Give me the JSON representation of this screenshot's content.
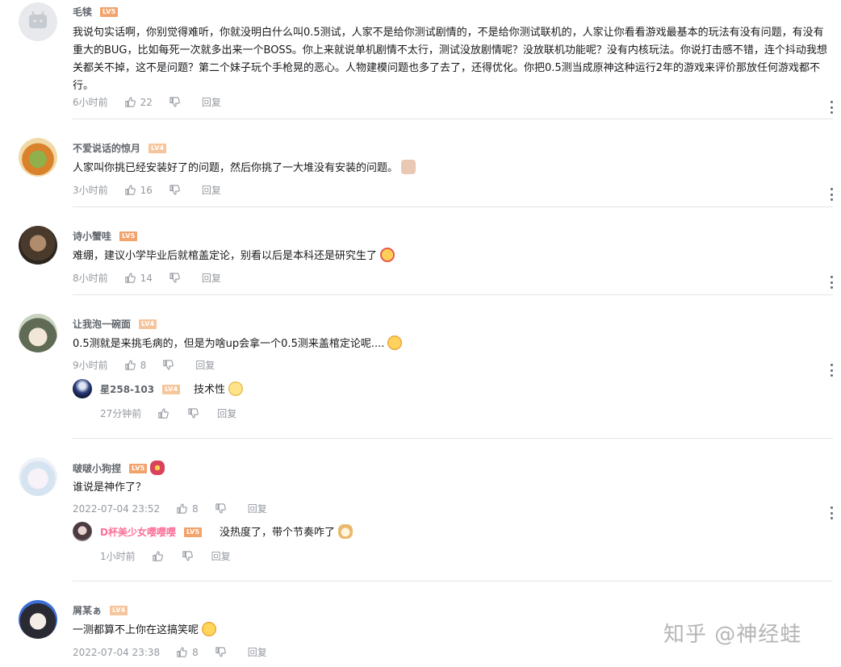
{
  "comments": [
    {
      "username": "毛犊",
      "level": "LV5",
      "text": "我说句实话啊，你别觉得难听，你就没明白什么叫0.5测试，人家不是给你测试剧情的，不是给你测试联机的，人家让你看看游戏最基本的玩法有没有问题，有没有重大的BUG，比如每死一次就多出来一个BOSS。你上来就说单机剧情不太行，测试没放剧情呢？没放联机功能呢？没有内核玩法。你说打击感不错，连个抖动我想关都关不掉，这不是问题？第二个妹子玩个手枪晃的恶心。人物建模问题也多了去了，还得优化。你把0.5测当成原神这种运行2年的游戏来评价那放任何游戏都不行。",
      "time": "6小时前",
      "likes": "22",
      "reply_label": "回复"
    },
    {
      "username": "不爱说话的惊月",
      "level": "LV4",
      "text": "人家叫你挑已经安装好了的问题，然后你挑了一大堆没有安装的问题。",
      "time": "3小时前",
      "likes": "16",
      "reply_label": "回复"
    },
    {
      "username": "诗小蟹哇",
      "level": "LV5",
      "text": "难绷，建议小学毕业后就棺盖定论，别看以后是本科还是研究生了",
      "time": "8小时前",
      "likes": "14",
      "reply_label": "回复"
    },
    {
      "username": "让我泡一碗面",
      "level": "LV4",
      "text": "0.5测就是来挑毛病的，但是为啥up会拿一个0.5测来盖棺定论呢....",
      "time": "9小时前",
      "likes": "8",
      "reply_label": "回复",
      "sub_reply": {
        "username": "星258-103",
        "level": "LV4",
        "text": "技术性",
        "time": "27分钟前",
        "reply_label": "回复"
      }
    },
    {
      "username": "啵啵小狗捏",
      "level": "LV5",
      "text": "谁说是神作了？",
      "time": "2022-07-04 23:52",
      "likes": "8",
      "reply_label": "回复",
      "sub_reply": {
        "username": "D杯美少女嘤嘤嘤",
        "level": "LV5",
        "text": "没热度了，带个节奏咋了",
        "time": "1小时前",
        "reply_label": "回复"
      }
    },
    {
      "username": "屑某ぁ",
      "level": "LV4",
      "text": "一测都算不上你在这搞笑呢",
      "time": "2022-07-04 23:38",
      "likes": "8",
      "reply_label": "回复"
    }
  ],
  "watermark": "知乎 @神经蛙",
  "colors": {
    "level_orange": "#f3a46d",
    "level_light": "#f6c59c",
    "pink_name": "#fb7299",
    "meta_gray": "#9499a0",
    "divider": "#e3e5e7"
  }
}
